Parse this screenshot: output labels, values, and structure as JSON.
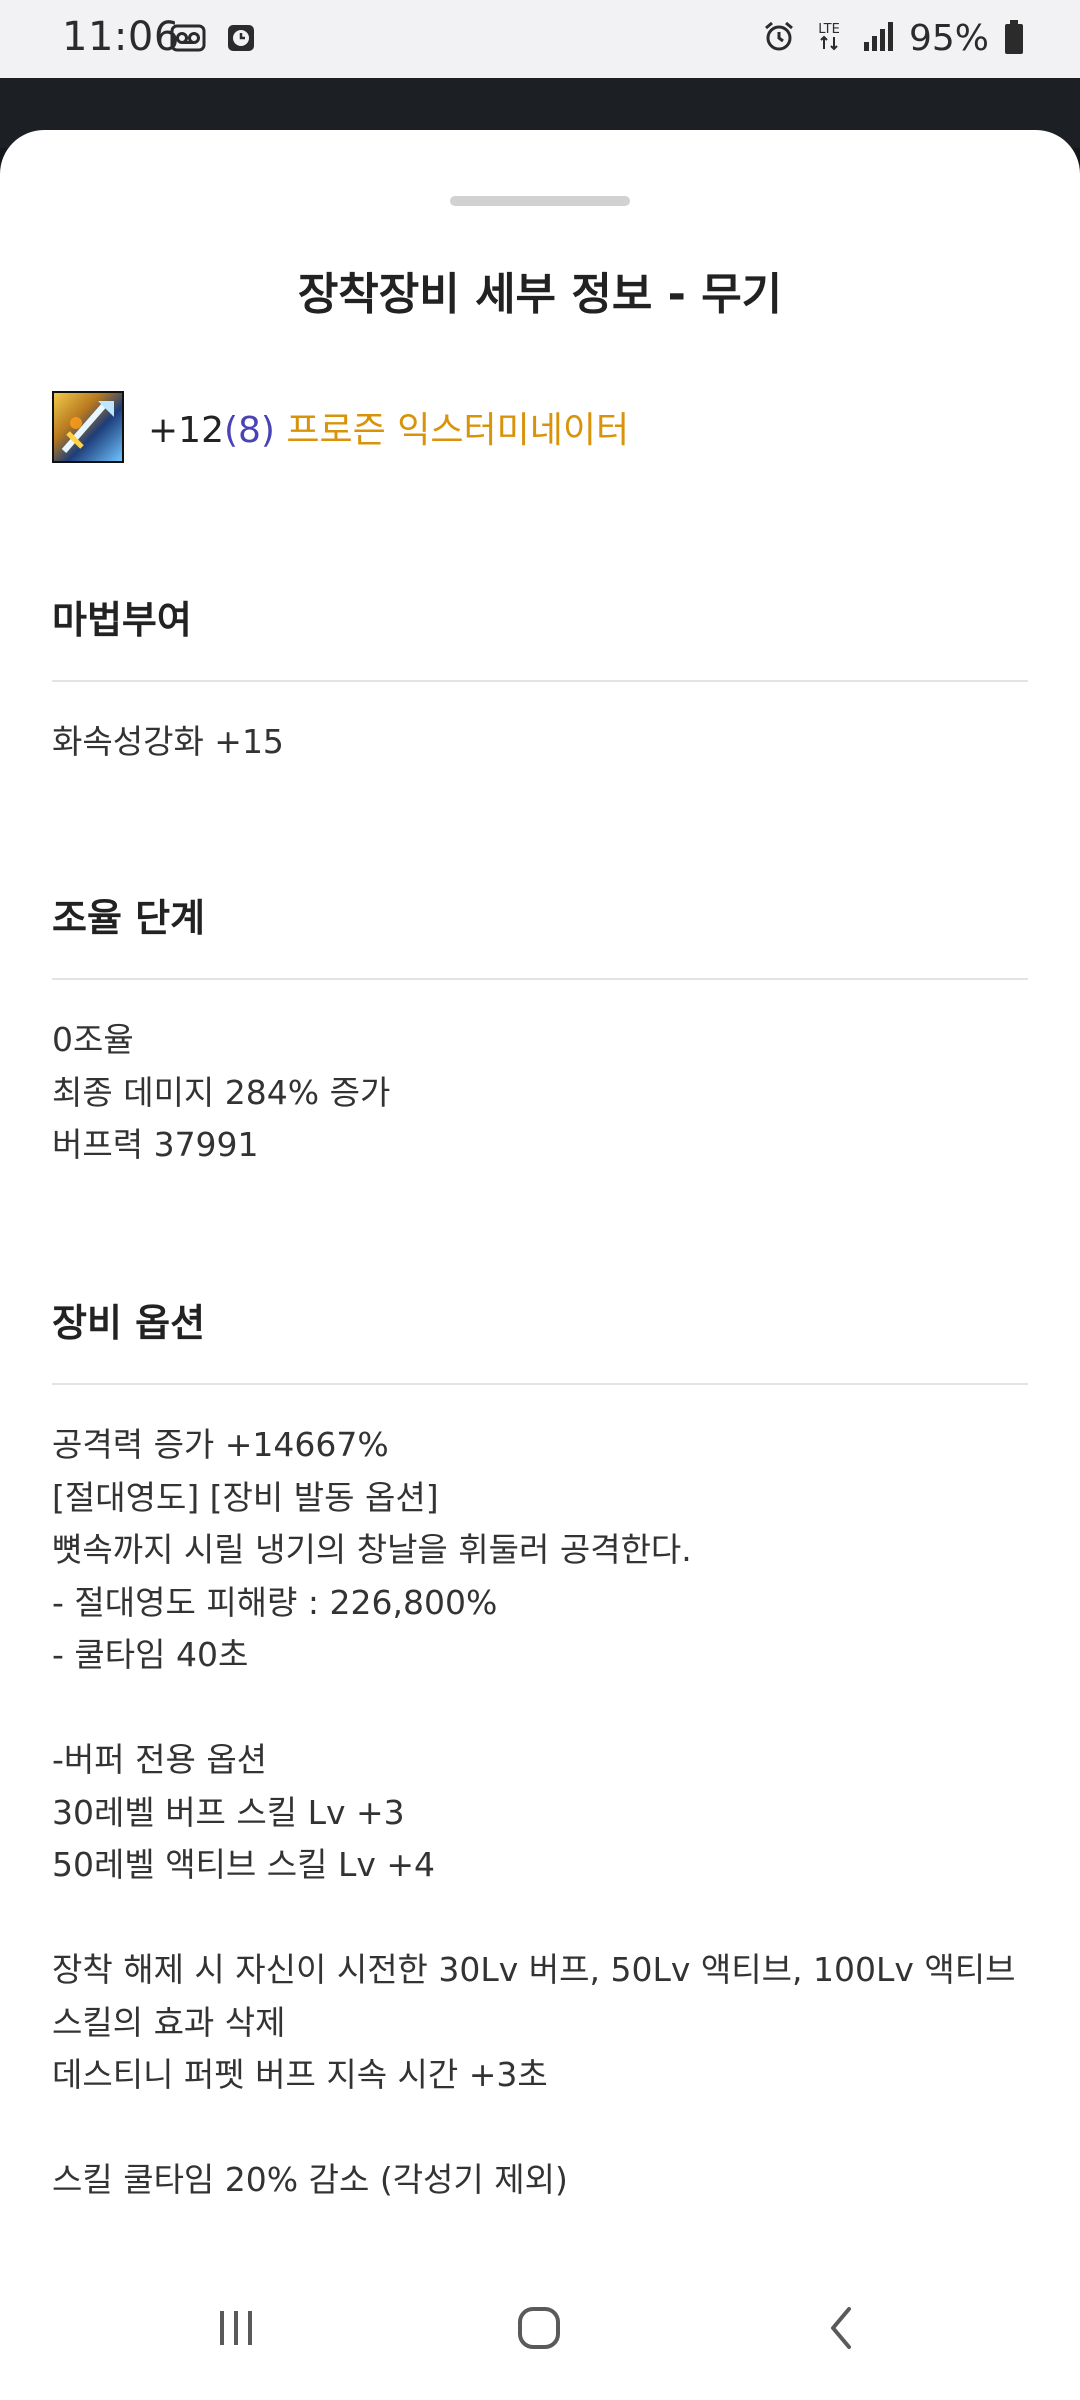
{
  "status_bar": {
    "time": "11:06",
    "network": "LTE",
    "battery": "95%"
  },
  "sheet": {
    "title": "장착장비 세부 정보 - 무기"
  },
  "item": {
    "enhance": "+12",
    "amplify": "(8)",
    "name": " 프로즌 익스터미네이터"
  },
  "sections": {
    "enchant": {
      "header": "마법부여",
      "lines": [
        "화속성강화 +15"
      ]
    },
    "tuning": {
      "header": "조율 단계",
      "lines": [
        "0조율",
        "최종 데미지 284% 증가",
        "버프력 37991"
      ]
    },
    "options": {
      "header": "장비 옵션",
      "lines": [
        "공격력 증가 +14667%",
        "[절대영도] [장비 발동 옵션]",
        "뼛속까지 시릴 냉기의 창날을 휘둘러 공격한다.",
        "- 절대영도 피해량 : 226,800%",
        "- 쿨타임 40초",
        "",
        "-버퍼 전용 옵션",
        "30레벨 버프 스킬 Lv +3",
        "50레벨 액티브 스킬 Lv +4",
        "",
        "장착 해제 시 자신이 시전한 30Lv 버프, 50Lv 액티브, 100Lv 액티브 스킬의 효과 삭제",
        "데스티니 퍼펫 버프 지속 시간 +3초",
        "",
        "스킬 쿨타임 20% 감소 (각성기 제외)"
      ]
    }
  },
  "icons": {
    "status_left": [
      "voicemail-icon",
      "clock-app-icon"
    ],
    "status_right": [
      "alarm-icon",
      "lte-icon",
      "signal-icon",
      "battery-icon"
    ],
    "nav": [
      "recents-icon",
      "home-icon",
      "back-icon"
    ]
  },
  "colors": {
    "enhance": "#222222",
    "amplify": "#4a43b5",
    "item_name": "#d9930b"
  }
}
